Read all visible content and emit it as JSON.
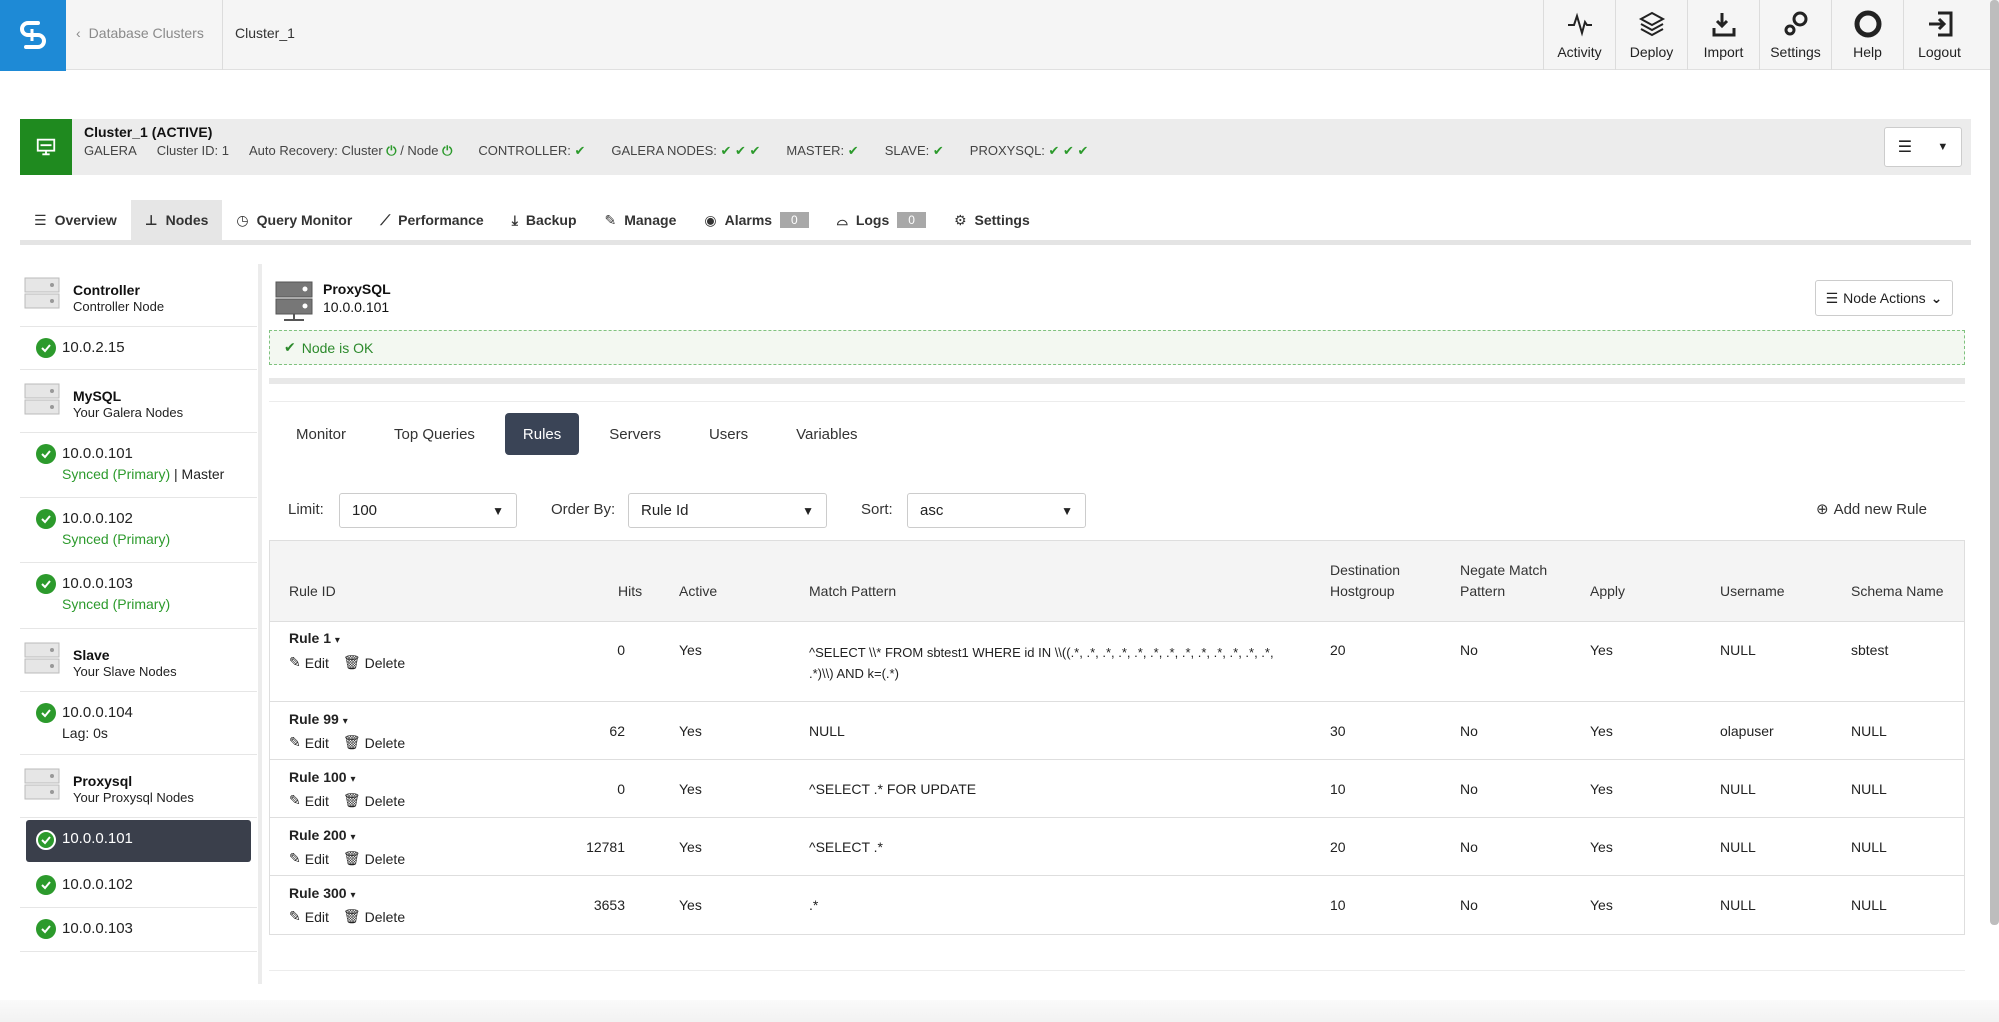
{
  "header": {
    "back_label": "Database Clusters",
    "current": "Cluster_1",
    "buttons": [
      {
        "label": "Activity",
        "icon": "activity-icon"
      },
      {
        "label": "Deploy",
        "icon": "deploy-icon"
      },
      {
        "label": "Import",
        "icon": "import-icon"
      },
      {
        "label": "Settings",
        "icon": "settings-icon"
      },
      {
        "label": "Help",
        "icon": "help-icon"
      },
      {
        "label": "Logout",
        "icon": "logout-icon"
      }
    ]
  },
  "cluster": {
    "name": "Cluster_1 (ACTIVE)",
    "type": "GALERA",
    "cluster_id": "Cluster ID: 1",
    "auto_recovery": "Auto Recovery: Cluster",
    "node_label": "/ Node",
    "controller": "CONTROLLER:",
    "galera_nodes": "GALERA NODES:",
    "master": "MASTER:",
    "slave": "SLAVE:",
    "proxysql": "PROXYSQL:"
  },
  "tabs": [
    {
      "label": "Overview"
    },
    {
      "label": "Nodes"
    },
    {
      "label": "Query Monitor"
    },
    {
      "label": "Performance"
    },
    {
      "label": "Backup"
    },
    {
      "label": "Manage"
    },
    {
      "label": "Alarms",
      "badge": "0"
    },
    {
      "label": "Logs",
      "badge": "0"
    },
    {
      "label": "Settings"
    }
  ],
  "sidebar": {
    "groups": [
      {
        "title": "Controller",
        "subtitle": "Controller Node",
        "nodes": [
          {
            "ip": "10.0.2.15"
          }
        ]
      },
      {
        "title": "MySQL",
        "subtitle": "Your Galera Nodes",
        "nodes": [
          {
            "ip": "10.0.0.101",
            "status": "Synced (Primary)",
            "extra": " | Master"
          },
          {
            "ip": "10.0.0.102",
            "status": "Synced (Primary)"
          },
          {
            "ip": "10.0.0.103",
            "status": "Synced (Primary)"
          }
        ]
      },
      {
        "title": "Slave",
        "subtitle": "Your Slave Nodes",
        "nodes": [
          {
            "ip": "10.0.0.104",
            "lag": "Lag: 0s"
          }
        ]
      },
      {
        "title": "Proxysql",
        "subtitle": "Your Proxysql Nodes",
        "nodes": [
          {
            "ip": "10.0.0.101",
            "active": true
          },
          {
            "ip": "10.0.0.102"
          },
          {
            "ip": "10.0.0.103"
          }
        ]
      }
    ]
  },
  "node": {
    "name": "ProxySQL",
    "ip": "10.0.0.101",
    "actions_label": "Node Actions",
    "status": "Node is OK"
  },
  "subtabs": [
    "Monitor",
    "Top Queries",
    "Rules",
    "Servers",
    "Users",
    "Variables"
  ],
  "filters": {
    "limit_label": "Limit:",
    "limit_value": "100",
    "order_label": "Order By:",
    "order_value": "Rule Id",
    "sort_label": "Sort:",
    "sort_value": "asc",
    "add_rule": "Add new Rule"
  },
  "table": {
    "headers": {
      "rule_id": "Rule ID",
      "hits": "Hits",
      "active": "Active",
      "match": "Match Pattern",
      "dest1": "Destination",
      "dest2": "Hostgroup",
      "negate1": "Negate Match",
      "negate2": "Pattern",
      "apply": "Apply",
      "username": "Username",
      "schema": "Schema Name"
    },
    "edit_label": "Edit",
    "delete_label": "Delete",
    "rows": [
      {
        "rule": "Rule 1",
        "hits": "0",
        "active": "Yes",
        "match": "^SELECT \\\\* FROM sbtest1 WHERE id IN \\\\((.*, .*, .*, .*, .*, .*, .*, .*, .*, .*, .*, .*, .*, .*)\\\\) AND k=(.*)",
        "dest": "20",
        "negate": "No",
        "apply": "Yes",
        "username": "NULL",
        "schema": "sbtest"
      },
      {
        "rule": "Rule 99",
        "hits": "62",
        "active": "Yes",
        "match": "NULL",
        "dest": "30",
        "negate": "No",
        "apply": "Yes",
        "username": "olapuser",
        "schema": "NULL"
      },
      {
        "rule": "Rule 100",
        "hits": "0",
        "active": "Yes",
        "match": "^SELECT .* FOR UPDATE",
        "dest": "10",
        "negate": "No",
        "apply": "Yes",
        "username": "NULL",
        "schema": "NULL"
      },
      {
        "rule": "Rule 200",
        "hits": "12781",
        "active": "Yes",
        "match": "^SELECT .*",
        "dest": "20",
        "negate": "No",
        "apply": "Yes",
        "username": "NULL",
        "schema": "NULL"
      },
      {
        "rule": "Rule 300",
        "hits": "3653",
        "active": "Yes",
        "match": ".*",
        "dest": "10",
        "negate": "No",
        "apply": "Yes",
        "username": "NULL",
        "schema": "NULL"
      }
    ]
  },
  "colors": {
    "brand": "#1e8ad6",
    "ok": "#2c9a2c",
    "active_tab": "#3a4456"
  }
}
